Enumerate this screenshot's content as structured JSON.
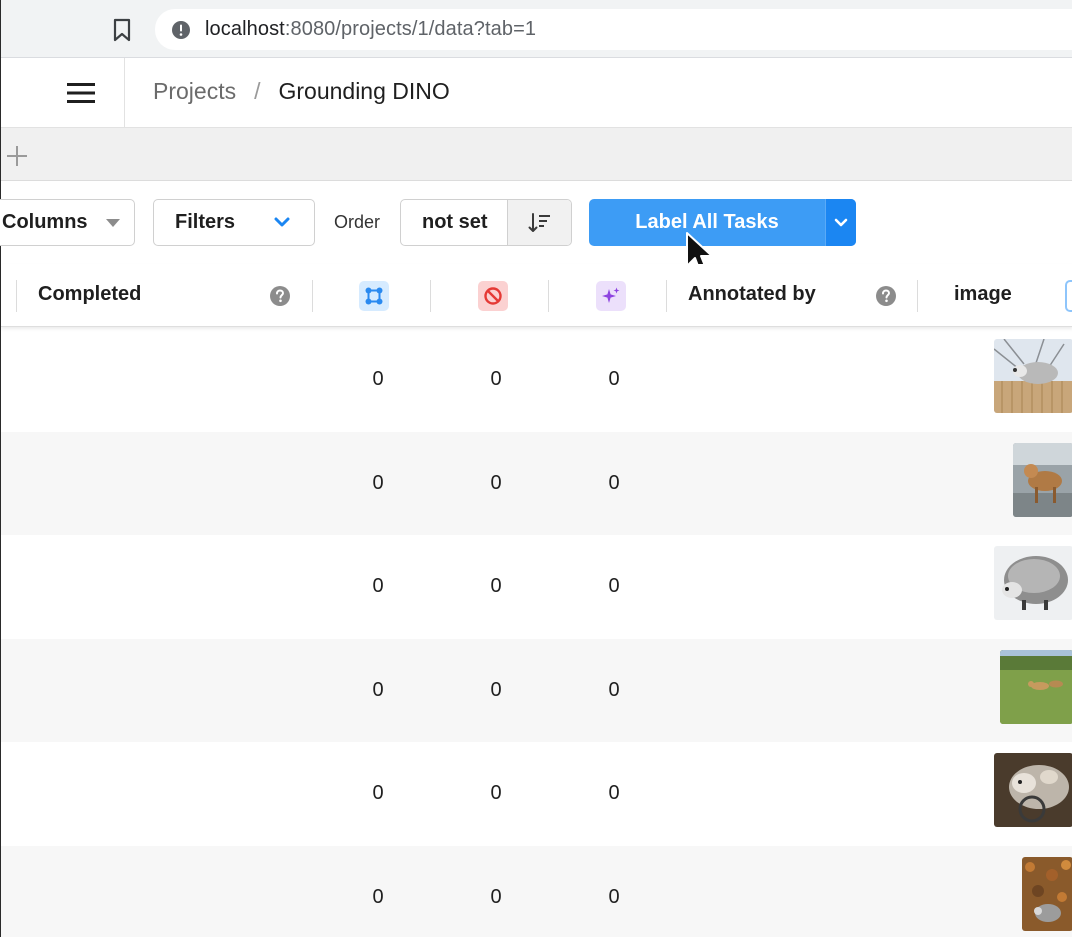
{
  "browser": {
    "url_host": "localhost",
    "url_path": ":8080/projects/1/data?tab=1"
  },
  "header": {
    "breadcrumb": [
      "Projects",
      "/",
      "Grounding DINO"
    ]
  },
  "toolbar": {
    "columns_label": "Columns",
    "filters_label": "Filters",
    "order_label": "Order",
    "order_value": "not set",
    "label_all_label": "Label All Tasks"
  },
  "table": {
    "headers": {
      "completed": "Completed",
      "annotated_by": "Annotated by",
      "image": "image"
    },
    "header_icons": [
      "annotations-icon",
      "cancelled-icon",
      "predictions-icon"
    ],
    "rows": [
      {
        "annotations": "0",
        "cancelled": "0",
        "predictions": "0",
        "image": "opossum-on-fence"
      },
      {
        "annotations": "0",
        "cancelled": "0",
        "predictions": "0",
        "image": "dog-on-street"
      },
      {
        "annotations": "0",
        "cancelled": "0",
        "predictions": "0",
        "image": "opossum-in-snow"
      },
      {
        "annotations": "0",
        "cancelled": "0",
        "predictions": "0",
        "image": "dogs-on-grass"
      },
      {
        "annotations": "0",
        "cancelled": "0",
        "predictions": "0",
        "image": "opossum-with-young"
      },
      {
        "annotations": "0",
        "cancelled": "0",
        "predictions": "0",
        "image": "animal-in-leaves"
      }
    ]
  },
  "colors": {
    "primary": "#3d9cf5",
    "primary_dark": "#1b86f2",
    "row_alt": "#f7f7f7"
  }
}
